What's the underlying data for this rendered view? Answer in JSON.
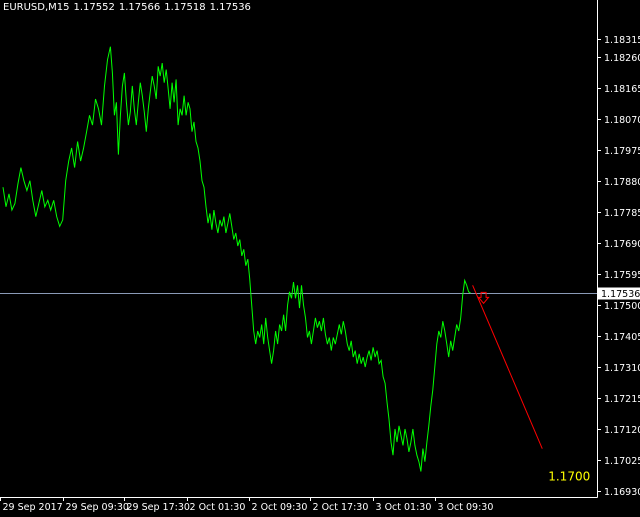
{
  "header": {
    "symbol_timeframe": "EURUSD,M15",
    "open": "1.17552",
    "high": "1.17566",
    "low": "1.17518",
    "close": "1.17536"
  },
  "chart_data": {
    "type": "line",
    "title": "",
    "colors": {
      "background": "#000000",
      "price_line": "#00ff00",
      "axis": "#ffffff",
      "bid_line": "#8a9ab6",
      "projection": "#ff0000",
      "arrow": "#ff0000",
      "target_label": "#ffff00"
    },
    "yaxis": {
      "range": [
        1.16912,
        1.18433
      ],
      "ticks": [
        "1.18315",
        "1.18260",
        "1.18165",
        "1.18070",
        "1.17975",
        "1.17880",
        "1.17785",
        "1.17690",
        "1.17595",
        "1.17500",
        "1.17405",
        "1.17310",
        "1.17215",
        "1.17120",
        "1.17025",
        "1.16930"
      ]
    },
    "xaxis": {
      "range": [
        0,
        600
      ],
      "tick_labels": [
        "29 Sep 2017",
        "29 Sep 09:30",
        "29 Sep 17:30",
        "2 Oct 01:30",
        "2 Oct 09:30",
        "2 Oct 17:30",
        "3 Oct 01:30",
        "3 Oct 09:30"
      ],
      "tick_positions": [
        0,
        63,
        125,
        188,
        250,
        312,
        375,
        437
      ]
    },
    "current_price": {
      "value": 1.17536,
      "label": "1.17536"
    },
    "series": [
      {
        "values": [
          [
            3,
            1.1786
          ],
          [
            6,
            1.178
          ],
          [
            9,
            1.1784
          ],
          [
            12,
            1.1779
          ],
          [
            15,
            1.1781
          ],
          [
            18,
            1.1787
          ],
          [
            21,
            1.1792
          ],
          [
            24,
            1.1788
          ],
          [
            27,
            1.1785
          ],
          [
            30,
            1.1788
          ],
          [
            33,
            1.1782
          ],
          [
            36,
            1.1777
          ],
          [
            39,
            1.1781
          ],
          [
            42,
            1.1785
          ],
          [
            45,
            1.178
          ],
          [
            48,
            1.1782
          ],
          [
            51,
            1.1779
          ],
          [
            54,
            1.1782
          ],
          [
            57,
            1.1777
          ],
          [
            60,
            1.1774
          ],
          [
            63,
            1.1776
          ],
          [
            66,
            1.1788
          ],
          [
            69,
            1.1794
          ],
          [
            72,
            1.1798
          ],
          [
            75,
            1.1792
          ],
          [
            78,
            1.18
          ],
          [
            81,
            1.1794
          ],
          [
            84,
            1.1798
          ],
          [
            87,
            1.1803
          ],
          [
            90,
            1.1808
          ],
          [
            93,
            1.1805
          ],
          [
            96,
            1.1813
          ],
          [
            99,
            1.181
          ],
          [
            102,
            1.1805
          ],
          [
            105,
            1.1817
          ],
          [
            108,
            1.1825
          ],
          [
            111,
            1.1829
          ],
          [
            113,
            1.1821
          ],
          [
            115,
            1.1808
          ],
          [
            117,
            1.1812
          ],
          [
            119,
            1.1796
          ],
          [
            121,
            1.1808
          ],
          [
            123,
            1.1817
          ],
          [
            125,
            1.1821
          ],
          [
            127,
            1.1812
          ],
          [
            129,
            1.1805
          ],
          [
            131,
            1.1809
          ],
          [
            133,
            1.1817
          ],
          [
            135,
            1.181
          ],
          [
            137,
            1.1805
          ],
          [
            139,
            1.1812
          ],
          [
            141,
            1.1818
          ],
          [
            143,
            1.1814
          ],
          [
            145,
            1.1809
          ],
          [
            147,
            1.1803
          ],
          [
            149,
            1.181
          ],
          [
            151,
            1.1815
          ],
          [
            153,
            1.182
          ],
          [
            155,
            1.1817
          ],
          [
            157,
            1.1813
          ],
          [
            159,
            1.1823
          ],
          [
            161,
            1.182
          ],
          [
            163,
            1.1824
          ],
          [
            165,
            1.1818
          ],
          [
            167,
            1.1822
          ],
          [
            169,
            1.1816
          ],
          [
            171,
            1.181
          ],
          [
            173,
            1.1818
          ],
          [
            175,
            1.1812
          ],
          [
            177,
            1.1819
          ],
          [
            179,
            1.1805
          ],
          [
            181,
            1.181
          ],
          [
            183,
            1.1808
          ],
          [
            185,
            1.1814
          ],
          [
            187,
            1.1808
          ],
          [
            189,
            1.1812
          ],
          [
            191,
            1.181
          ],
          [
            193,
            1.1803
          ],
          [
            195,
            1.1806
          ],
          [
            197,
            1.18
          ],
          [
            199,
            1.1798
          ],
          [
            201,
            1.1794
          ],
          [
            203,
            1.1788
          ],
          [
            205,
            1.1786
          ],
          [
            207,
            1.178
          ],
          [
            209,
            1.1775
          ],
          [
            211,
            1.1778
          ],
          [
            213,
            1.1773
          ],
          [
            215,
            1.1779
          ],
          [
            217,
            1.1775
          ],
          [
            219,
            1.1772
          ],
          [
            221,
            1.1776
          ],
          [
            223,
            1.1774
          ],
          [
            225,
            1.1777
          ],
          [
            227,
            1.1772
          ],
          [
            229,
            1.1775
          ],
          [
            231,
            1.1778
          ],
          [
            233,
            1.1774
          ],
          [
            235,
            1.177
          ],
          [
            237,
            1.1772
          ],
          [
            239,
            1.1768
          ],
          [
            241,
            1.177
          ],
          [
            243,
            1.1765
          ],
          [
            245,
            1.1767
          ],
          [
            247,
            1.1762
          ],
          [
            249,
            1.1764
          ],
          [
            251,
            1.1758
          ],
          [
            253,
            1.175
          ],
          [
            255,
            1.1742
          ],
          [
            257,
            1.1738
          ],
          [
            259,
            1.1742
          ],
          [
            261,
            1.174
          ],
          [
            263,
            1.1744
          ],
          [
            265,
            1.1738
          ],
          [
            267,
            1.1746
          ],
          [
            269,
            1.174
          ],
          [
            271,
            1.1736
          ],
          [
            273,
            1.1732
          ],
          [
            275,
            1.1736
          ],
          [
            277,
            1.1742
          ],
          [
            279,
            1.1738
          ],
          [
            281,
            1.1744
          ],
          [
            283,
            1.1742
          ],
          [
            285,
            1.1747
          ],
          [
            287,
            1.1742
          ],
          [
            289,
            1.175
          ],
          [
            291,
            1.1754
          ],
          [
            293,
            1.1752
          ],
          [
            295,
            1.1757
          ],
          [
            297,
            1.1752
          ],
          [
            299,
            1.1756
          ],
          [
            301,
            1.1749
          ],
          [
            303,
            1.1756
          ],
          [
            305,
            1.175
          ],
          [
            307,
            1.1746
          ],
          [
            309,
            1.174
          ],
          [
            311,
            1.1742
          ],
          [
            313,
            1.1738
          ],
          [
            315,
            1.1742
          ],
          [
            317,
            1.1746
          ],
          [
            319,
            1.1743
          ],
          [
            321,
            1.1745
          ],
          [
            323,
            1.1742
          ],
          [
            325,
            1.1746
          ],
          [
            327,
            1.1741
          ],
          [
            329,
            1.1738
          ],
          [
            331,
            1.174
          ],
          [
            333,
            1.1736
          ],
          [
            335,
            1.174
          ],
          [
            337,
            1.1738
          ],
          [
            339,
            1.1741
          ],
          [
            341,
            1.1744
          ],
          [
            343,
            1.1741
          ],
          [
            345,
            1.1745
          ],
          [
            347,
            1.1742
          ],
          [
            349,
            1.1738
          ],
          [
            351,
            1.1736
          ],
          [
            353,
            1.1739
          ],
          [
            355,
            1.1734
          ],
          [
            357,
            1.1736
          ],
          [
            359,
            1.1732
          ],
          [
            361,
            1.1735
          ],
          [
            363,
            1.1732
          ],
          [
            365,
            1.1734
          ],
          [
            367,
            1.1731
          ],
          [
            369,
            1.1734
          ],
          [
            371,
            1.1736
          ],
          [
            373,
            1.1733
          ],
          [
            375,
            1.1737
          ],
          [
            377,
            1.1734
          ],
          [
            379,
            1.1736
          ],
          [
            381,
            1.1732
          ],
          [
            383,
            1.1733
          ],
          [
            385,
            1.1728
          ],
          [
            387,
            1.1726
          ],
          [
            389,
            1.172
          ],
          [
            391,
            1.1715
          ],
          [
            393,
            1.1708
          ],
          [
            395,
            1.1704
          ],
          [
            397,
            1.1712
          ],
          [
            399,
            1.1708
          ],
          [
            401,
            1.1713
          ],
          [
            403,
            1.171
          ],
          [
            405,
            1.1707
          ],
          [
            407,
            1.1712
          ],
          [
            409,
            1.1709
          ],
          [
            411,
            1.1705
          ],
          [
            413,
            1.1708
          ],
          [
            415,
            1.1712
          ],
          [
            417,
            1.1707
          ],
          [
            419,
            1.1704
          ],
          [
            421,
            1.1702
          ],
          [
            423,
            1.1699
          ],
          [
            425,
            1.1706
          ],
          [
            427,
            1.1702
          ],
          [
            429,
            1.1708
          ],
          [
            431,
            1.1713
          ],
          [
            433,
            1.1719
          ],
          [
            435,
            1.1724
          ],
          [
            437,
            1.1731
          ],
          [
            439,
            1.1738
          ],
          [
            441,
            1.1742
          ],
          [
            443,
            1.174
          ],
          [
            445,
            1.1745
          ],
          [
            447,
            1.1742
          ],
          [
            449,
            1.1738
          ],
          [
            451,
            1.1734
          ],
          [
            453,
            1.1739
          ],
          [
            455,
            1.1736
          ],
          [
            457,
            1.174
          ],
          [
            459,
            1.1744
          ],
          [
            461,
            1.1742
          ],
          [
            463,
            1.1746
          ],
          [
            465,
            1.1753
          ],
          [
            467,
            1.17575
          ],
          [
            469,
            1.1756
          ],
          [
            471,
            1.1754
          ],
          [
            473,
            1.17536
          ]
        ]
      }
    ],
    "annotations": {
      "projection_line": {
        "from": [
          475,
          1.1756
        ],
        "to": [
          545,
          1.1706
        ]
      },
      "arrow": {
        "x": 486,
        "value": 1.1752,
        "direction": "down"
      },
      "target_label": {
        "text": "1.1700",
        "x": 551,
        "value": 1.16975
      }
    }
  }
}
